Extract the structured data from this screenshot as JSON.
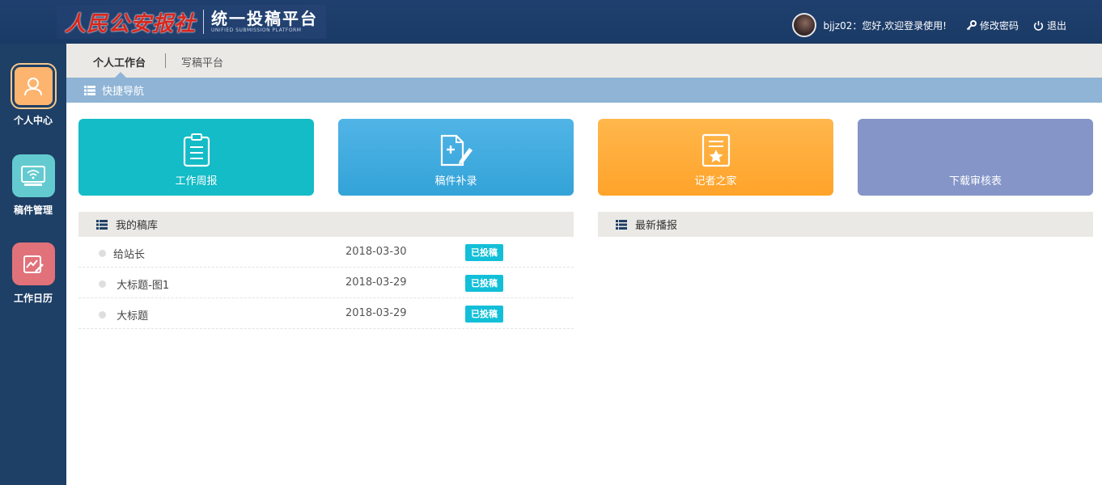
{
  "header": {
    "brand": "人民公安报社",
    "platform_title": "统一投稿平台",
    "platform_subtitle": "UNIFIED SUBMISSION PLATFORM",
    "greeting": "bjjz02：您好,欢迎登录使用!",
    "change_password": "修改密码",
    "logout": "退出"
  },
  "sidebar": {
    "items": [
      {
        "label": "个人中心",
        "icon": "user-icon",
        "color": "#fdb46f"
      },
      {
        "label": "稿件管理",
        "icon": "wifi-screen-icon",
        "color": "#63cbd0"
      },
      {
        "label": "工作日历",
        "icon": "chart-edit-icon",
        "color": "#e1727a"
      }
    ]
  },
  "tabs": [
    {
      "label": "个人工作台",
      "active": true
    },
    {
      "label": "写稿平台",
      "active": false
    }
  ],
  "quicknav": {
    "title": "快捷导航",
    "cards": [
      {
        "label": "工作周报",
        "icon": "clipboard-icon",
        "color": "#13bcc6"
      },
      {
        "label": "稿件补录",
        "icon": "document-add-icon",
        "color": "#3fa9dd"
      },
      {
        "label": "记者之家",
        "icon": "certificate-star-icon",
        "color": "#fea632"
      },
      {
        "label": "下载审核表",
        "icon": "",
        "color": "#8595c8"
      }
    ]
  },
  "my_library": {
    "title": "我的稿库",
    "rows": [
      {
        "title": "给站长",
        "date": "2018-03-30",
        "status": "已投稿"
      },
      {
        "title": " 大标题-图1",
        "date": "2018-03-29",
        "status": "已投稿"
      },
      {
        "title": " 大标题",
        "date": "2018-03-29",
        "status": "已投稿"
      }
    ]
  },
  "latest": {
    "title": "最新播报"
  },
  "colors": {
    "header_bg": "#1f3f6e",
    "sidebar_bg": "#1e3f66",
    "quicknav_bar": "#8fb4d6",
    "badge": "#13bfd8"
  }
}
